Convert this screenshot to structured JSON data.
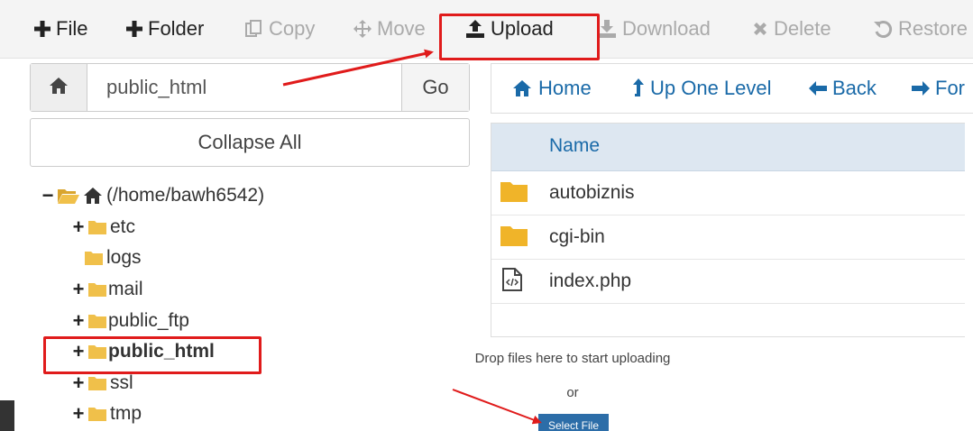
{
  "toolbar": {
    "items": [
      {
        "label": "File",
        "icon": "plus-icon",
        "enabled": true
      },
      {
        "label": "Folder",
        "icon": "plus-icon",
        "enabled": true
      },
      {
        "label": "Copy",
        "icon": "copy-icon",
        "enabled": false
      },
      {
        "label": "Move",
        "icon": "move-icon",
        "enabled": false
      },
      {
        "label": "Upload",
        "icon": "upload-icon",
        "enabled": true
      },
      {
        "label": "Download",
        "icon": "download-icon",
        "enabled": false
      },
      {
        "label": "Delete",
        "icon": "delete-icon",
        "enabled": false
      },
      {
        "label": "Restore",
        "icon": "restore-icon",
        "enabled": false
      }
    ]
  },
  "pathbar": {
    "value": "public_html",
    "go_label": "Go"
  },
  "collapse_label": "Collapse All",
  "tree": {
    "root": "(/home/bawh6542)",
    "items": [
      {
        "label": "etc",
        "expandable": true
      },
      {
        "label": "logs",
        "expandable": false
      },
      {
        "label": "mail",
        "expandable": true
      },
      {
        "label": "public_ftp",
        "expandable": true
      },
      {
        "label": "public_html",
        "expandable": true,
        "selected": true
      },
      {
        "label": "ssl",
        "expandable": true
      },
      {
        "label": "tmp",
        "expandable": true
      }
    ]
  },
  "nav": {
    "home": "Home",
    "up": "Up One Level",
    "back": "Back",
    "forward": "For"
  },
  "files": {
    "header": "Name",
    "rows": [
      {
        "name": "autobiznis",
        "type": "folder"
      },
      {
        "name": "cgi-bin",
        "type": "folder"
      },
      {
        "name": "index.php",
        "type": "code-file"
      }
    ]
  },
  "upload": {
    "drop_text": "Drop files here to start uploading",
    "or_text": "or",
    "select_label": "Select File"
  },
  "colors": {
    "accent": "#1a6aa8",
    "folder": "#f0c04a",
    "highlight": "#e01b1b",
    "header_bg": "#dde7f1"
  }
}
